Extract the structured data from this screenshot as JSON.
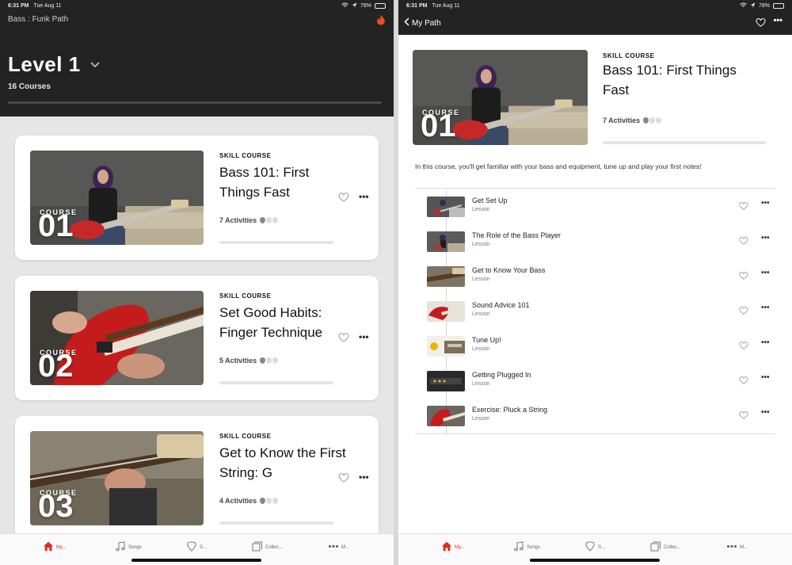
{
  "status_left": {
    "time": "6:31 PM",
    "date": "Tue Aug 11",
    "battery": "78%"
  },
  "status_right": {
    "time": "6:31 PM",
    "date": "Tue Aug 11",
    "battery": "78%"
  },
  "left": {
    "path_label": "Bass :  Funk Path",
    "level_title": "Level 1",
    "course_count": "16 Courses",
    "cards": [
      {
        "kicker": "SKILL COURSE",
        "title": "Bass 101: First Things Fast",
        "activities": "7 Activities",
        "course_word": "COURSE",
        "course_num": "01",
        "picks_filled": 1
      },
      {
        "kicker": "SKILL COURSE",
        "title": "Set Good Habits: Finger Technique",
        "activities": "5 Activities",
        "course_word": "COURSE",
        "course_num": "02",
        "picks_filled": 1
      },
      {
        "kicker": "SKILL COURSE",
        "title": "Get to Know the First String: G",
        "activities": "4 Activities",
        "course_word": "COURSE",
        "course_num": "03",
        "picks_filled": 1
      }
    ]
  },
  "right": {
    "back_label": "My Path",
    "kicker": "SKILL COURSE",
    "title": "Bass 101: First Things Fast",
    "activities": "7 Activities",
    "course_word": "COURSE",
    "course_num": "01",
    "description": "In this course, you'll get familiar with your bass and equipment, tune up and play your first notes!",
    "lessons": [
      {
        "title": "Get Set Up",
        "type": "Lesson"
      },
      {
        "title": "The Role of the Bass Player",
        "type": "Lesson"
      },
      {
        "title": "Get to Know Your Bass",
        "type": "Lesson"
      },
      {
        "title": "Sound Advice 101",
        "type": "Lesson"
      },
      {
        "title": "Tune Up!",
        "type": "Lesson"
      },
      {
        "title": "Getting Plugged In",
        "type": "Lesson"
      },
      {
        "title": "Exercise: Pluck a String",
        "type": "Lesson"
      }
    ]
  },
  "tabbar": {
    "tabs": [
      {
        "label": "My...",
        "icon": "home-icon",
        "active": true
      },
      {
        "label": "Songs",
        "icon": "music-note-icon",
        "active": false
      },
      {
        "label": "S...",
        "icon": "guitar-pick-icon",
        "active": false
      },
      {
        "label": "Collec...",
        "icon": "collection-icon",
        "active": false
      },
      {
        "label": "M...",
        "icon": "more-icon",
        "active": false
      }
    ]
  },
  "colors": {
    "accent": "#d93025",
    "header_bg": "#232323",
    "flame": "#e8501f"
  },
  "more_glyph": "•••"
}
